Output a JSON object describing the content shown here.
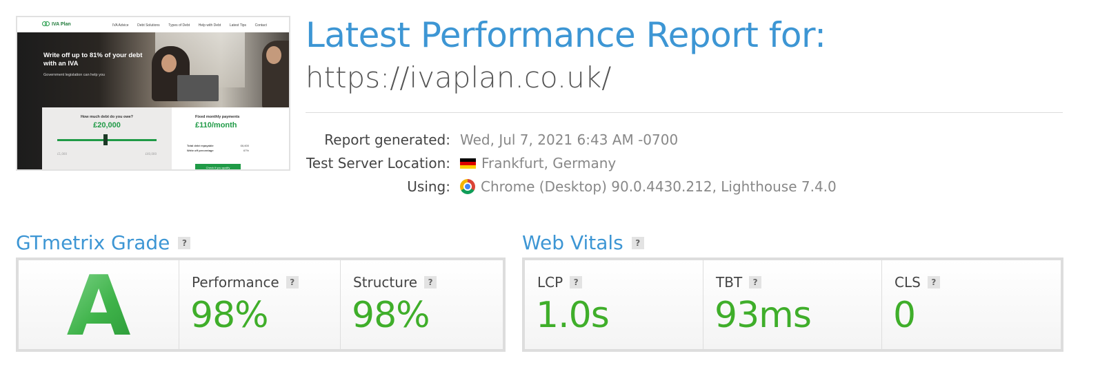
{
  "thumbnail": {
    "logo": "IVA Plan",
    "nav_links": [
      "IVA Advice",
      "Debt Solutions",
      "Types of Debt",
      "Help with Debt",
      "Latest Tips",
      "Contact"
    ],
    "headline": "Write off up to 81% of your debt with an IVA",
    "subheadline": "Government legislation can help you",
    "debt_question": "How much debt do you owe?",
    "debt_amount": "£20,000",
    "slider_min": "£1,000",
    "slider_max": "£40,000",
    "payment_label": "Fixed monthly payments",
    "payment_amount": "£110/month",
    "total_label": "Total debt repayable",
    "total_value": "£6,600",
    "writeoff_label": "Write off percentage",
    "writeoff_value": "67%",
    "cta": "Check if you qualify"
  },
  "header": {
    "title": "Latest Performance Report for:",
    "url": "https://ivaplan.co.uk/"
  },
  "meta": {
    "generated_label": "Report generated:",
    "generated_value": "Wed, Jul 7, 2021 6:43 AM -0700",
    "location_label": "Test Server Location:",
    "location_value": "Frankfurt, Germany",
    "using_label": "Using:",
    "using_value": "Chrome (Desktop) 90.0.4430.212, Lighthouse 7.4.0"
  },
  "grade_section": {
    "title": "GTmetrix Grade",
    "help": "?",
    "grade": "A",
    "performance_label": "Performance",
    "performance_value": "98%",
    "structure_label": "Structure",
    "structure_value": "98%"
  },
  "vitals_section": {
    "title": "Web Vitals",
    "help": "?",
    "lcp_label": "LCP",
    "lcp_value": "1.0s",
    "tbt_label": "TBT",
    "tbt_value": "93ms",
    "cls_label": "CLS",
    "cls_value": "0"
  },
  "colors": {
    "accent_blue": "#3d96d4",
    "good_green": "#3fae2a"
  },
  "icons": {
    "location_flag": "germany-flag-icon",
    "browser": "chrome-icon",
    "help": "help-icon"
  }
}
